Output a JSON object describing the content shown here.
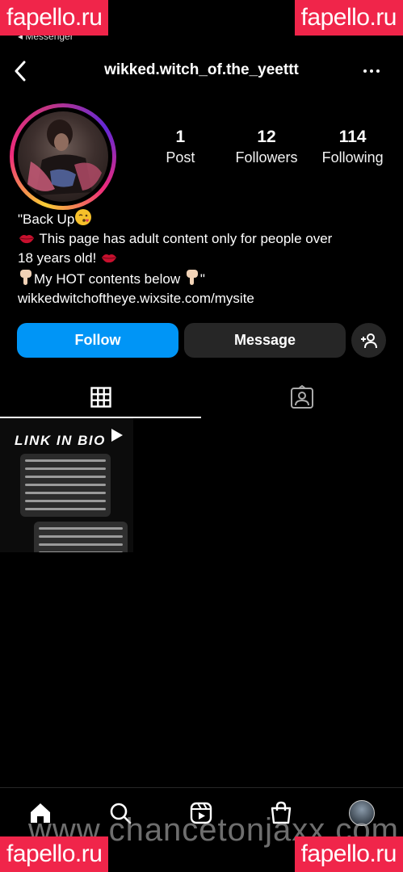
{
  "watermarks": {
    "tl": "fapello.ru",
    "tr": "fapello.ru",
    "bl": "fapello.ru",
    "br": "fapello.ru",
    "overlay": "www.chancetonjaxx.com"
  },
  "status": {
    "back_app": "◂ Messenger"
  },
  "header": {
    "username": "wikked.witch_of.the_yeettt"
  },
  "stats": [
    {
      "num": "1",
      "label": "Post"
    },
    {
      "num": "12",
      "label": "Followers"
    },
    {
      "num": "114",
      "label": "Following"
    }
  ],
  "bio": {
    "line1": "\"Back Up",
    "line2": "This page has adult content only for people over",
    "line3": "18 years old!",
    "line4_a": "My HOT contents below",
    "line4_b": "\"",
    "link": "wikkedwitchoftheye.wixsite.com/mysite"
  },
  "buttons": {
    "follow": "Follow",
    "message": "Message"
  },
  "post": {
    "title": "LINK IN BIO"
  },
  "colors": {
    "follow_blue": "#0095f6",
    "button_gray": "#262626",
    "watermark_red": "#f0254a"
  },
  "icons": {
    "back": "chevron-left-icon",
    "more": "more-icon",
    "add_person": "add-person-icon",
    "grid": "grid-icon",
    "tagged": "tagged-icon",
    "home": "home-icon",
    "search": "search-icon",
    "reels": "reels-icon",
    "shop": "shop-icon"
  }
}
